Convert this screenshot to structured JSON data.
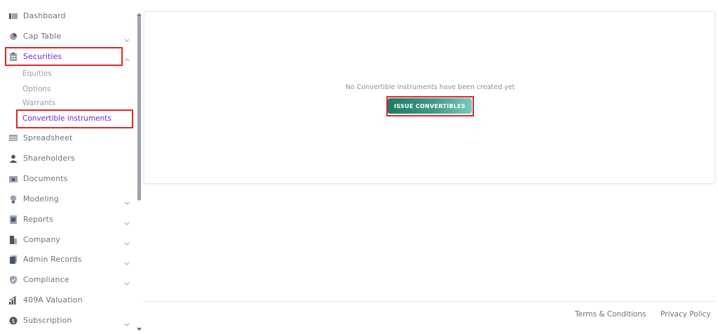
{
  "sidebar": {
    "items": [
      {
        "label": "Dashboard",
        "icon": "dashboard-icon"
      },
      {
        "label": "Cap Table",
        "icon": "pie-chart-icon",
        "expandable": true
      },
      {
        "label": "Securities",
        "icon": "clipboard-icon",
        "expandable": true,
        "expanded": true,
        "active": true
      },
      {
        "label": "Spreadsheet",
        "icon": "spreadsheet-icon"
      },
      {
        "label": "Shareholders",
        "icon": "user-icon"
      },
      {
        "label": "Documents",
        "icon": "folder-icon"
      },
      {
        "label": "Modeling",
        "icon": "lightbulb-icon",
        "expandable": true
      },
      {
        "label": "Reports",
        "icon": "report-icon",
        "expandable": true
      },
      {
        "label": "Company",
        "icon": "building-icon",
        "expandable": true
      },
      {
        "label": "Admin Records",
        "icon": "records-icon",
        "expandable": true
      },
      {
        "label": "Compliance",
        "icon": "shield-icon",
        "expandable": true
      },
      {
        "label": "409A Valuation",
        "icon": "valuation-icon"
      },
      {
        "label": "Subscription",
        "icon": "dollar-icon",
        "expandable": true
      }
    ],
    "securities_sub": [
      {
        "label": "Equities"
      },
      {
        "label": "Options"
      },
      {
        "label": "Warrants"
      },
      {
        "label": "Convertible instruments",
        "active": true
      }
    ]
  },
  "main": {
    "empty_message": "No Convertible Instruments have been created yet",
    "issue_button": "ISSUE CONVERTIBLES"
  },
  "footer": {
    "terms": "Terms & Conditions",
    "privacy": "Privacy Policy"
  },
  "colors": {
    "accent": "#6d28d9",
    "highlight": "#dc2626",
    "button_start": "#1f7a63",
    "button_end": "#7cc8bf"
  }
}
